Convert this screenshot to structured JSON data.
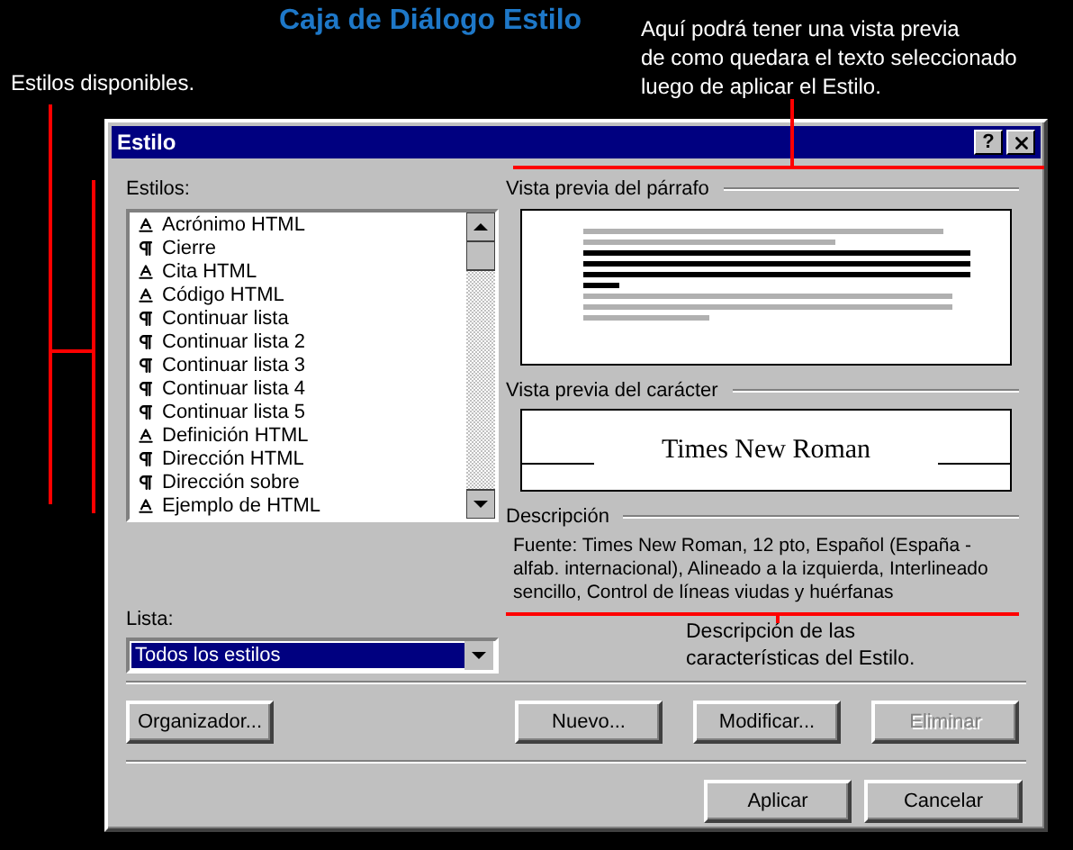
{
  "heading": "Caja de Diálogo Estilo",
  "annotations": [
    {
      "text": "Estilos disponibles."
    },
    {
      "text": "Aquí podrá tener una vista previa\nde como quedara el texto seleccionado\nluego de aplicar el Estilo."
    },
    {
      "text": "Descripción de las\ncaracterísticas del Estilo."
    }
  ],
  "window": {
    "title": "Estilo",
    "help_button": "?"
  },
  "styles_list": {
    "label": "Estilos:",
    "items": [
      {
        "kind": "character",
        "name": "Acrónimo HTML"
      },
      {
        "kind": "paragraph",
        "name": "Cierre"
      },
      {
        "kind": "character",
        "name": "Cita HTML"
      },
      {
        "kind": "character",
        "name": "Código HTML"
      },
      {
        "kind": "paragraph",
        "name": "Continuar lista"
      },
      {
        "kind": "paragraph",
        "name": "Continuar lista 2"
      },
      {
        "kind": "paragraph",
        "name": "Continuar lista 3"
      },
      {
        "kind": "paragraph",
        "name": "Continuar lista 4"
      },
      {
        "kind": "paragraph",
        "name": "Continuar lista 5"
      },
      {
        "kind": "character",
        "name": "Definición HTML"
      },
      {
        "kind": "paragraph",
        "name": "Dirección HTML"
      },
      {
        "kind": "paragraph",
        "name": "Dirección sobre"
      },
      {
        "kind": "character",
        "name": "Ejemplo de HTML"
      }
    ]
  },
  "list_filter": {
    "label": "Lista:",
    "value": "Todos los estilos",
    "selected": true
  },
  "paragraph_preview": {
    "label": "Vista previa del párrafo"
  },
  "character_preview": {
    "label": "Vista previa del carácter",
    "sample": "Times New Roman"
  },
  "description": {
    "label": "Descripción",
    "text": "Fuente: Times New Roman, 12 pto, Español (España - alfab. internacional), Alineado a la izquierda, Interlineado sencillo, Control de líneas viudas y huérfanas"
  },
  "buttons": [
    {
      "label": "Organizador...",
      "disabled": false
    },
    {
      "label": "Nuevo...",
      "disabled": false
    },
    {
      "label": "Modificar...",
      "disabled": false
    },
    {
      "label": "Eliminar",
      "disabled": true
    }
  ],
  "footer_buttons": [
    {
      "label": "Aplicar",
      "disabled": false
    },
    {
      "label": "Cancelar",
      "disabled": false
    }
  ]
}
